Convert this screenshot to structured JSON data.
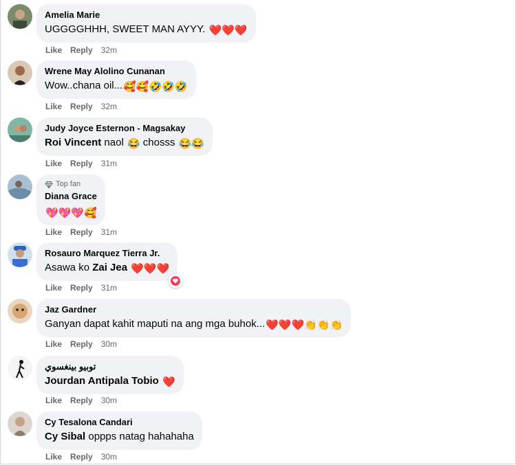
{
  "actions": {
    "like": "Like",
    "reply": "Reply"
  },
  "comments": [
    {
      "author": "Amelia Marie",
      "text": "UGGGGHHH, SWEET MAN AYYY.",
      "emojis": "❤️❤️❤️",
      "time": "32m"
    },
    {
      "author": "Wrene May Alolino Cunanan",
      "text": "Wow..chana oil...",
      "emojis": "🥰🥰🤣🤣🤣",
      "time": "32m"
    },
    {
      "author": "Judy Joyce Esternon - Magsakay",
      "mention": "Roi Vincent",
      "text": " naol ",
      "text2": " chosss ",
      "emojis": "😂😂😂",
      "time": "31m"
    },
    {
      "badge": "Top fan",
      "author": "Diana Grace",
      "text": "",
      "emojis": "💖💖💖🥰",
      "time": "31m"
    },
    {
      "author": "Rosauro Marquez Tierra Jr.",
      "text": "Asawa ko ",
      "mention": "Zai Jea",
      "emojis": "❤️❤️❤️",
      "time": "31m"
    },
    {
      "author": "Jaz Gardner",
      "text": "Ganyan dapat kahit maputi na ang mga buhok...",
      "emojis": "❤️❤️❤️👏👏👏",
      "time": "30m"
    },
    {
      "author": "توبيو بينغسوي",
      "mention": "Jourdan Antipala Tobio",
      "emojis": "❤️",
      "time": "30m"
    },
    {
      "author": "Cy Tesalona Candari",
      "mention": "Cy Sibal",
      "text": " oppps natag hahahaha",
      "time": "30m"
    }
  ]
}
